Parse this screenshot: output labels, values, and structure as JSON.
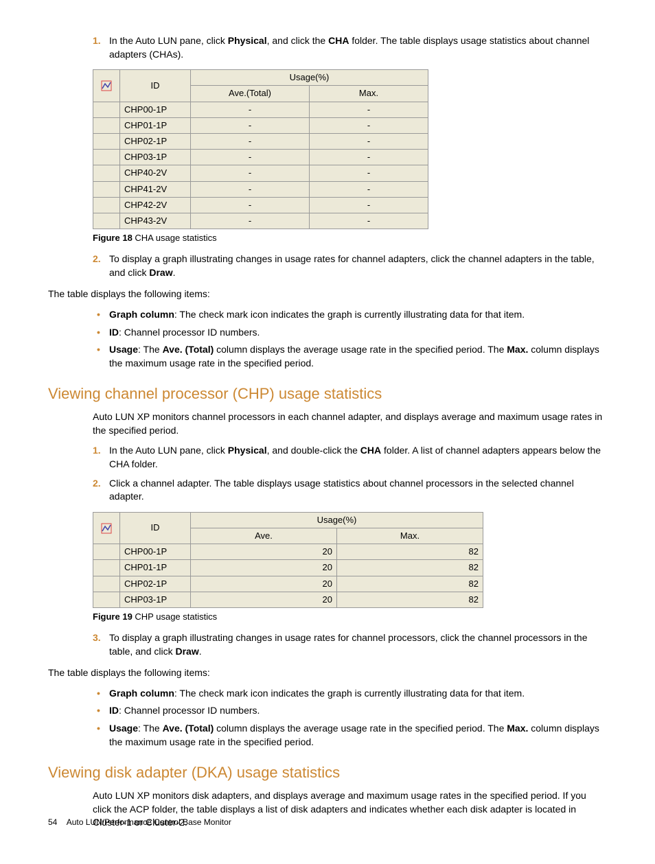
{
  "step1": {
    "num": "1.",
    "text_a": "In the Auto LUN pane, click ",
    "b1": "Physical",
    "text_b": ", and click the ",
    "b2": "CHA",
    "text_c": " folder. The table displays usage statistics about channel adapters (CHAs)."
  },
  "table1": {
    "headers": {
      "id": "ID",
      "usage": "Usage(%)",
      "ave": "Ave.(Total)",
      "max": "Max."
    },
    "rows": [
      {
        "id": "CHP00-1P",
        "ave": "-",
        "max": "-"
      },
      {
        "id": "CHP01-1P",
        "ave": "-",
        "max": "-"
      },
      {
        "id": "CHP02-1P",
        "ave": "-",
        "max": "-"
      },
      {
        "id": "CHP03-1P",
        "ave": "-",
        "max": "-"
      },
      {
        "id": "CHP40-2V",
        "ave": "-",
        "max": "-"
      },
      {
        "id": "CHP41-2V",
        "ave": "-",
        "max": "-"
      },
      {
        "id": "CHP42-2V",
        "ave": "-",
        "max": "-"
      },
      {
        "id": "CHP43-2V",
        "ave": "-",
        "max": "-"
      }
    ]
  },
  "fig18": {
    "label": "Figure 18",
    "caption": " CHA usage statistics"
  },
  "step2": {
    "num": "2.",
    "text_a": "To display a graph illustrating changes in usage rates for channel adapters, click the channel adapters in the table, and click ",
    "b1": "Draw",
    "text_b": "."
  },
  "paraA": "The table displays the following items:",
  "bulletsA": {
    "i1": {
      "b": "Graph column",
      "t": ": The check mark icon indicates the graph is currently illustrating data for that item."
    },
    "i2": {
      "b": "ID",
      "t": ": Channel processor ID numbers."
    },
    "i3": {
      "b1": "Usage",
      "t1": ": The ",
      "b2": "Ave. (Total)",
      "t2": " column displays the average usage rate in the specified period. The ",
      "b3": "Max.",
      "t3": " column displays the maximum usage rate in the specified period."
    }
  },
  "section2": {
    "title": "Viewing channel processor (CHP) usage statistics",
    "intro": "Auto LUN XP monitors channel processors in each channel adapter, and displays average and maximum usage rates in the specified period."
  },
  "s2step1": {
    "num": "1.",
    "text_a": "In the Auto LUN pane, click ",
    "b1": "Physical",
    "text_b": ", and double-click the ",
    "b2": "CHA",
    "text_c": " folder. A list of channel adapters appears below the CHA folder."
  },
  "s2step2": {
    "num": "2.",
    "text": "Click a channel adapter. The table displays usage statistics about channel processors in the selected channel adapter."
  },
  "table2": {
    "headers": {
      "id": "ID",
      "usage": "Usage(%)",
      "ave": "Ave.",
      "max": "Max."
    },
    "rows": [
      {
        "id": "CHP00-1P",
        "ave": "20",
        "max": "82"
      },
      {
        "id": "CHP01-1P",
        "ave": "20",
        "max": "82"
      },
      {
        "id": "CHP02-1P",
        "ave": "20",
        "max": "82"
      },
      {
        "id": "CHP03-1P",
        "ave": "20",
        "max": "82"
      }
    ]
  },
  "fig19": {
    "label": "Figure 19",
    "caption": " CHP usage statistics"
  },
  "s2step3": {
    "num": "3.",
    "text_a": "To display a graph illustrating changes in usage rates for channel processors, click the channel processors in the table, and click ",
    "b1": "Draw",
    "text_b": "."
  },
  "paraB": "The table displays the following items:",
  "bulletsB": {
    "i1": {
      "b": "Graph column",
      "t": ": The check mark icon indicates the graph is currently illustrating data for that item."
    },
    "i2": {
      "b": "ID",
      "t": ": Channel processor ID numbers."
    },
    "i3": {
      "b1": "Usage",
      "t1": ": The ",
      "b2": "Ave. (Total)",
      "t2": " column displays the average usage rate in the specified period. The ",
      "b3": "Max.",
      "t3": " column displays the maximum usage rate in the specified period."
    }
  },
  "section3": {
    "title": "Viewing disk adapter (DKA) usage statistics",
    "intro": "Auto LUN XP monitors disk adapters, and displays average and maximum usage rates in the specified period. If you click the ACP folder, the table displays a list of disk adapters and indicates whether each disk adapter is located in Cluster-1 or Cluster-2."
  },
  "footer": {
    "page": "54",
    "title": "Auto LUN/Performance Control Base Monitor"
  }
}
